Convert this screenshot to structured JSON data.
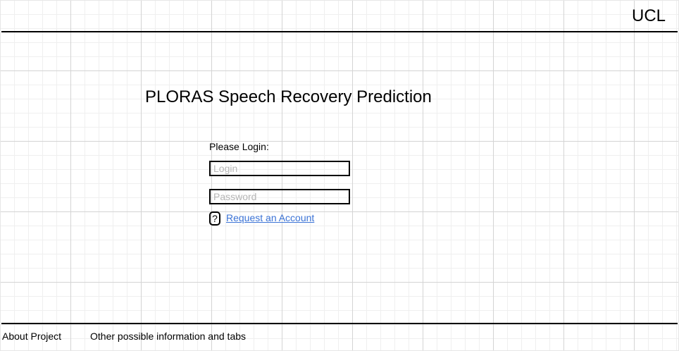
{
  "header": {
    "logo": "UCL"
  },
  "main": {
    "title": "PLORAS Speech Recovery Prediction",
    "login_prompt": "Please Login:",
    "login_placeholder": "Login",
    "password_placeholder": "Password",
    "help_icon": "?",
    "request_account_label": "Request an Account"
  },
  "footer": {
    "items": [
      {
        "label": "About Project"
      },
      {
        "label": "Other possible information and tabs"
      }
    ]
  },
  "colors": {
    "link": "#3b73d6",
    "placeholder": "#b5b5b5",
    "rule": "#000000",
    "grid": "#d4d4d4"
  }
}
